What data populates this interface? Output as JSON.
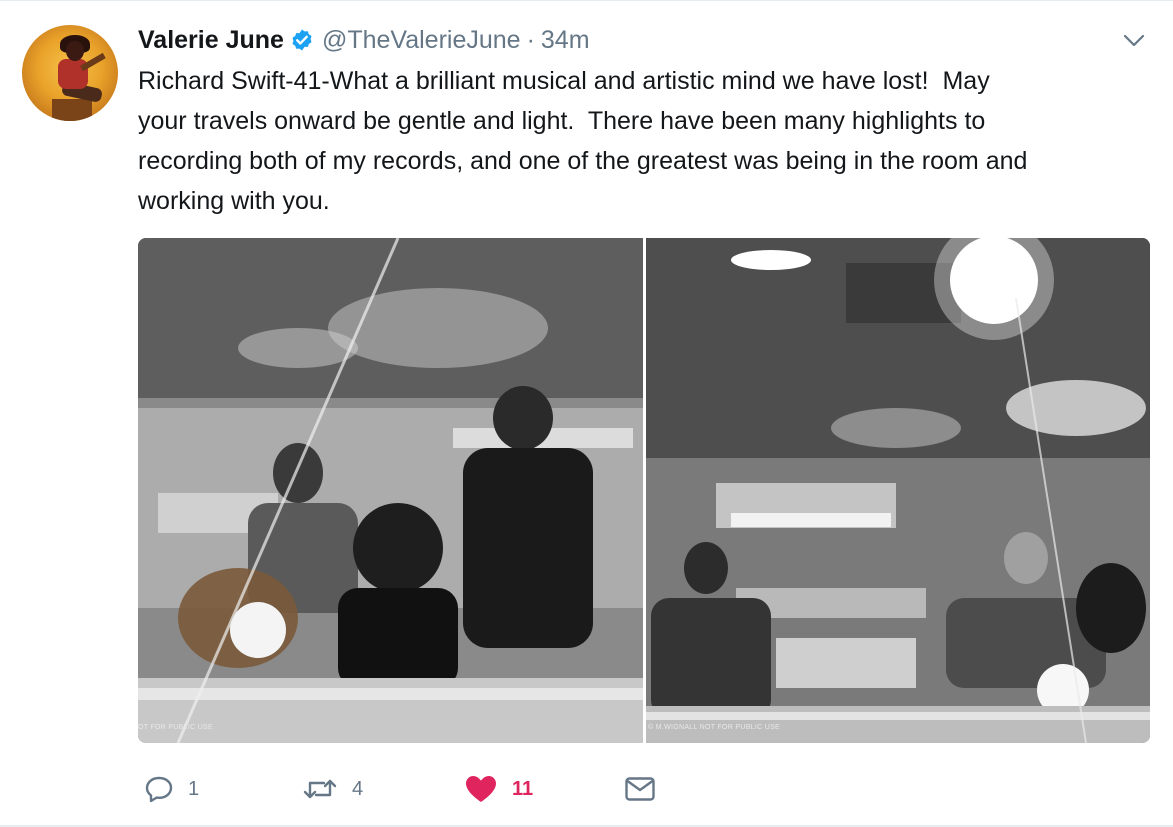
{
  "user": {
    "name": "Valerie June",
    "handle": "@TheValerieJune",
    "separator": "·",
    "time": "34m",
    "verified_icon": "verified-badge-icon",
    "verified_color": "#1da1f2"
  },
  "tweet": {
    "lines": [
      "Richard Swift-41-What a brilliant musical and artistic mind we have lost!  May",
      "your travels onward be gentle and light.  There have been many highlights to",
      "recording both of my records, and one of the greatest was being in the room and",
      "working with you."
    ]
  },
  "media": {
    "photo_left_watermark": "OT FOR PUBLIC USE",
    "photo_right_watermark": "© M.WIGNALL  NOT FOR PUBLIC USE"
  },
  "actions": {
    "reply_count": "1",
    "retweet_count": "4",
    "like_count": "11",
    "like_color": "#e0245e",
    "icons": [
      "reply-icon",
      "retweet-icon",
      "heart-icon",
      "direct-message-icon"
    ]
  },
  "menu": {
    "caret_icon": "chevron-down-icon"
  }
}
